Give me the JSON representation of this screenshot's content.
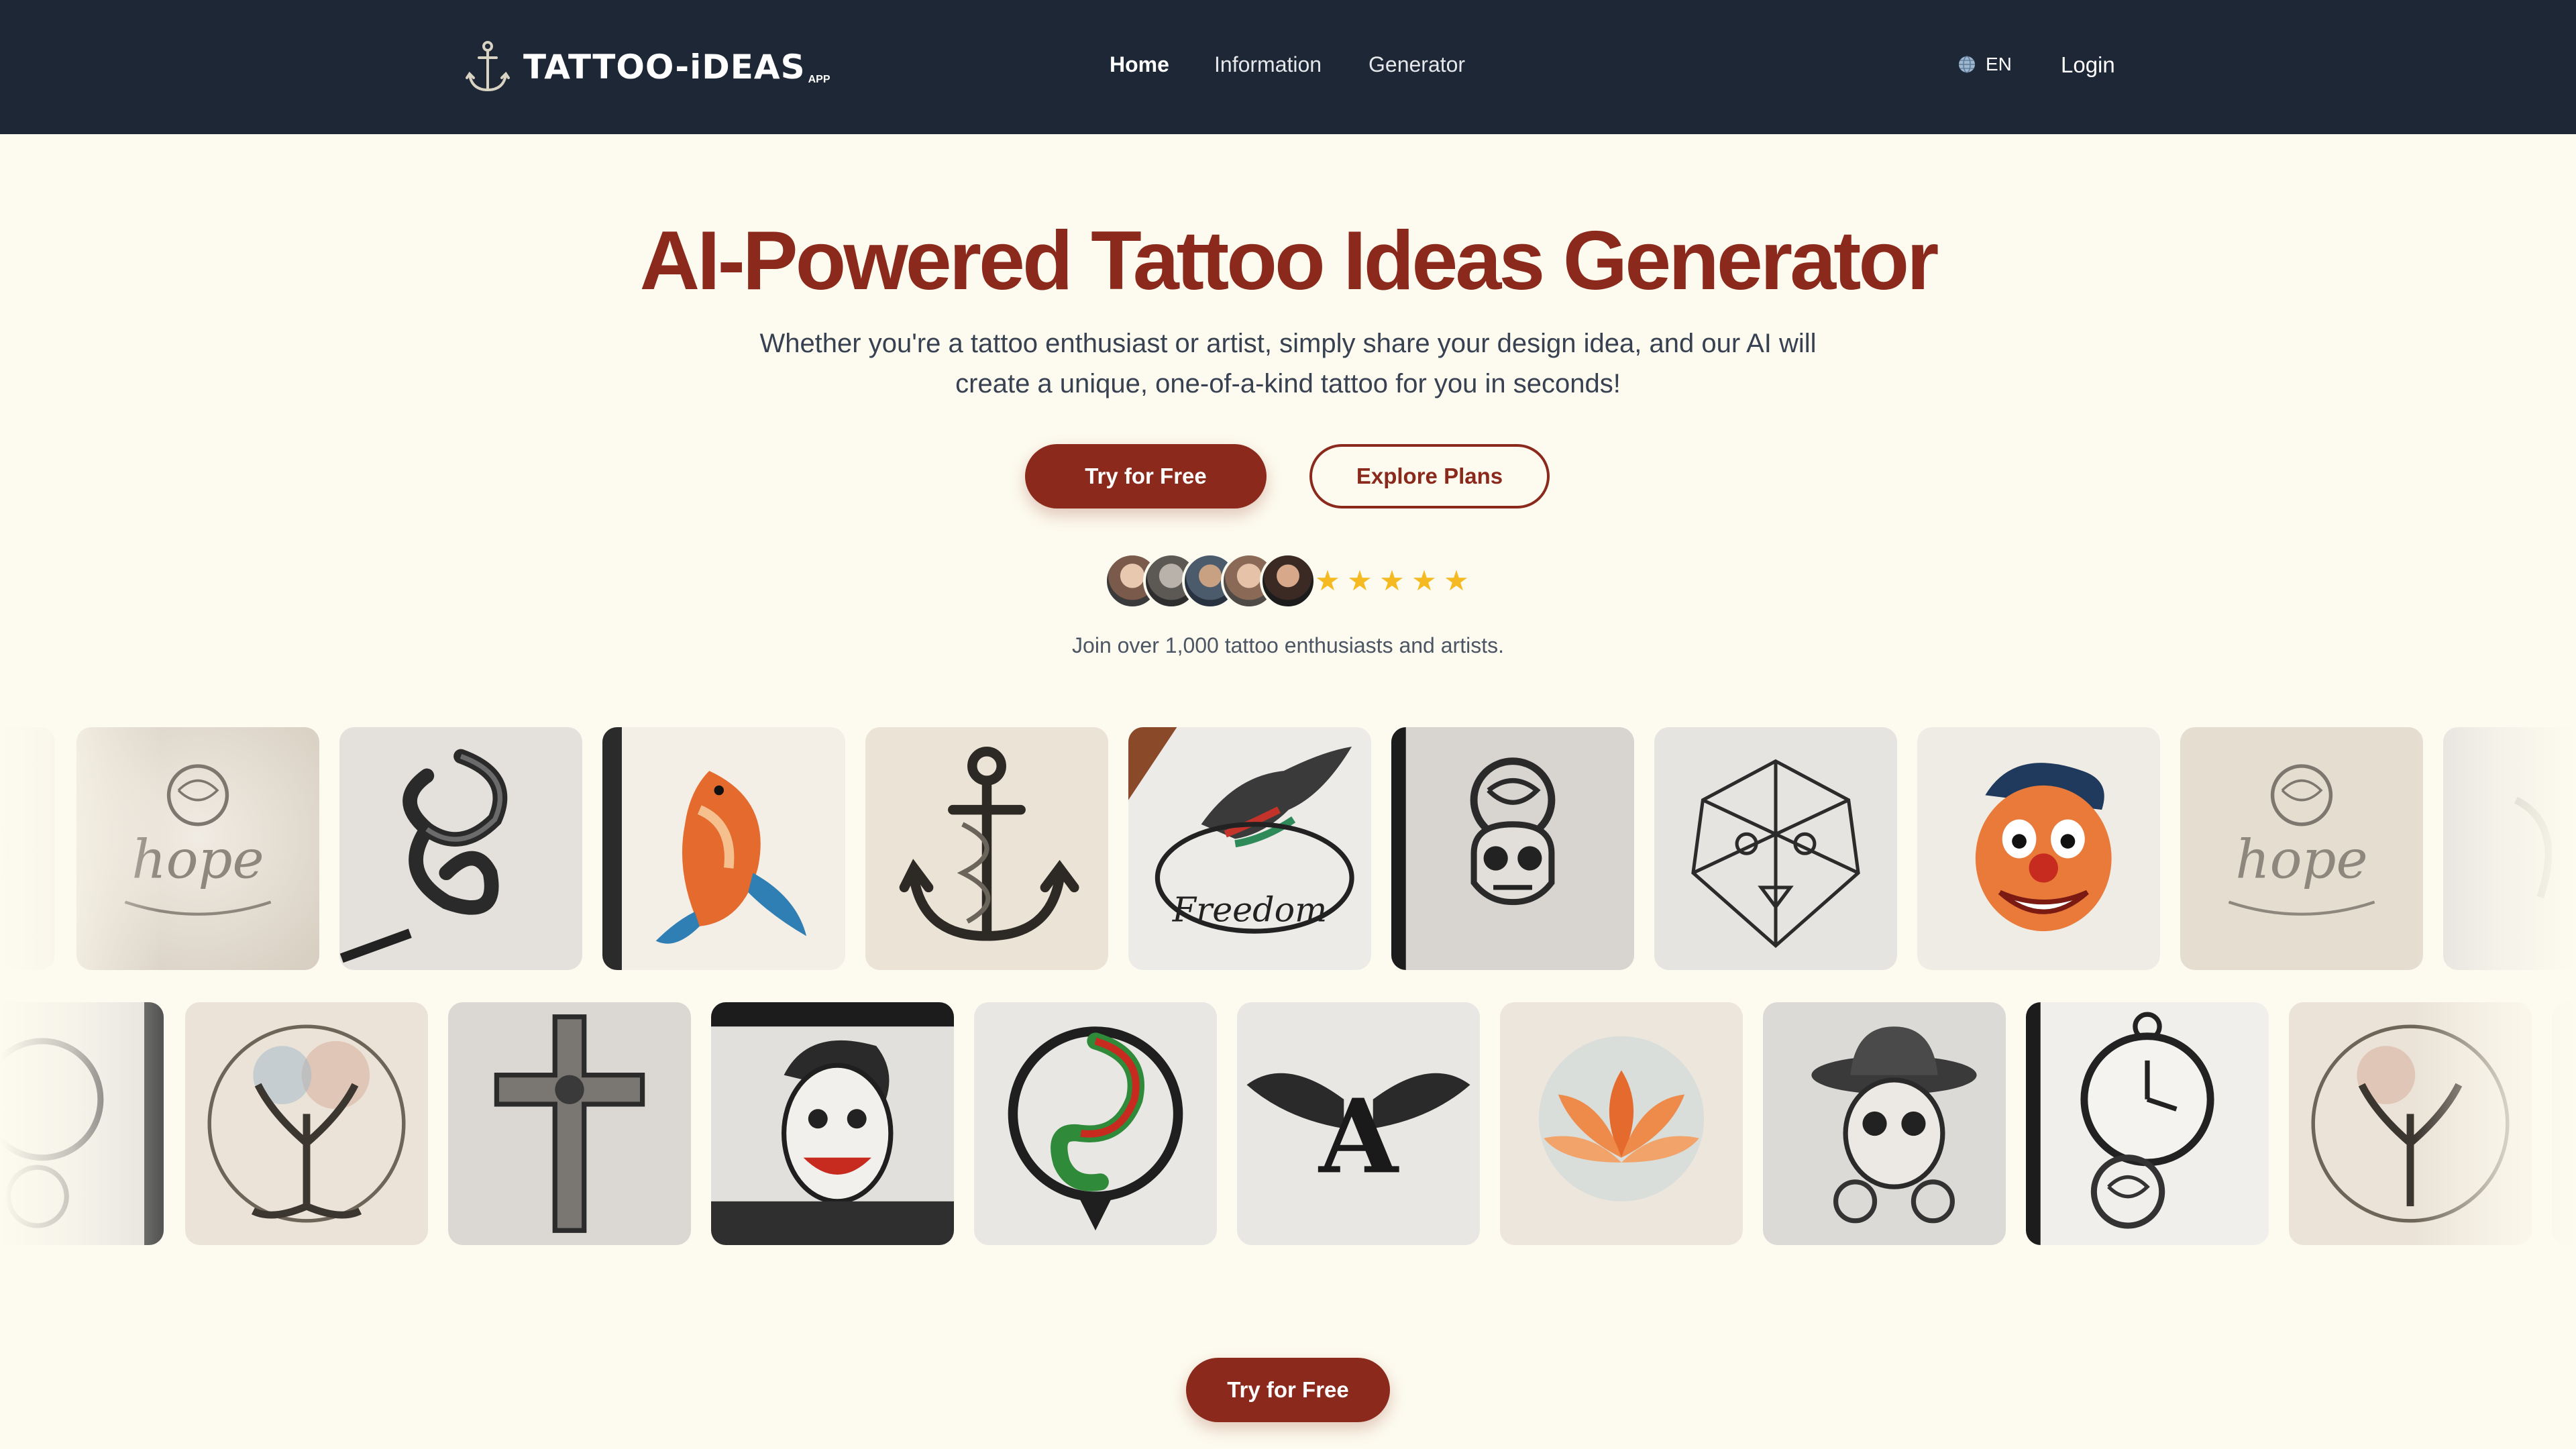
{
  "navbar": {
    "logo_text": "TATTOO-iDEAS",
    "logo_suffix": "APP",
    "links": [
      {
        "label": "Home",
        "active": true
      },
      {
        "label": "Information",
        "active": false
      },
      {
        "label": "Generator",
        "active": false
      }
    ],
    "language": "EN",
    "login_label": "Login"
  },
  "hero": {
    "title": "AI-Powered Tattoo Ideas Generator",
    "subtitle_line1": "Whether you're a tattoo enthusiast or artist, simply share your design idea, and our AI will",
    "subtitle_line2": "create a unique, one-of-a-kind tattoo for you in seconds!",
    "primary_button": "Try for Free",
    "secondary_button": "Explore Plans",
    "rating_stars": 5,
    "join_text": "Join over 1,000 tattoo enthusiasts and artists."
  },
  "gallery": {
    "row1": [
      "fading-partial-design",
      "hope-lettering-rose",
      "coiled-snake",
      "koi-fish",
      "ship-anchor",
      "freedom-eagle",
      "rose-skull",
      "geometric-lion",
      "grinning-clown",
      "hope-lettering-rose",
      "fading-partial-design"
    ],
    "row2": [
      "pocket-watch-rose-fading",
      "tree-of-life",
      "ornate-cross",
      "joker-portrait",
      "tribal-lizard",
      "winged-monogram",
      "lotus-flower",
      "sugar-skull-hat",
      "pocket-watch-rose",
      "tree-of-life-fading"
    ]
  },
  "bottom_cta": {
    "label": "Try for Free"
  },
  "colors": {
    "navbar_bg": "#1e2735",
    "page_bg": "#fdfbef",
    "brand": "#8b2a1c",
    "star": "#f5b921"
  }
}
